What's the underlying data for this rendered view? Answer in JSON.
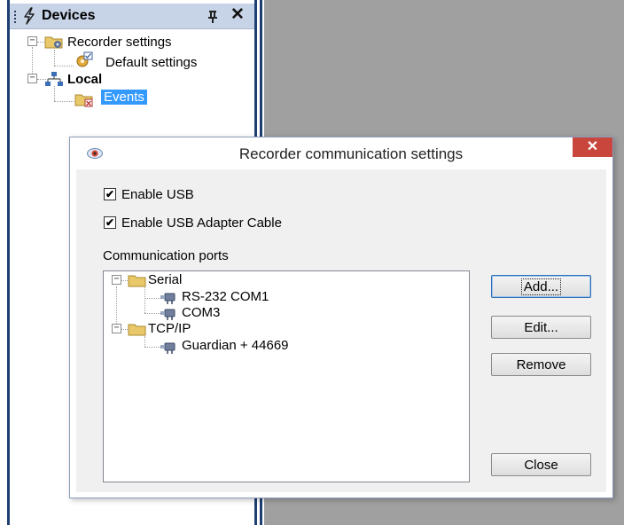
{
  "devices_pane": {
    "title": "Devices",
    "pin_glyph": "q",
    "close_glyph": "✕",
    "tree": [
      {
        "label": "Recorder settings",
        "icon": "folder-settings-icon",
        "expander": "−"
      },
      {
        "label": "Default settings",
        "icon": "gear-settings-icon"
      },
      {
        "label": "Local",
        "icon": "network-icon",
        "expander": "−"
      },
      {
        "label": "Events",
        "icon": "events-folder-icon",
        "selected": true
      }
    ]
  },
  "dialog": {
    "title": "Recorder communication settings",
    "close_glyph": "✕",
    "checkboxes": [
      {
        "label": "Enable USB",
        "checked": true,
        "mark": "✔"
      },
      {
        "label": "Enable USB Adapter Cable",
        "checked": true,
        "mark": "✔"
      }
    ],
    "ports_group_label": "Communication ports",
    "ports_tree": [
      {
        "label": "Serial",
        "icon": "folder-icon",
        "expander": "−"
      },
      {
        "label": "RS-232 COM1",
        "icon": "plug-icon"
      },
      {
        "label": "COM3",
        "icon": "plug-icon"
      },
      {
        "label": "TCP/IP",
        "icon": "folder-icon",
        "expander": "−"
      },
      {
        "label": "Guardian + 44669",
        "icon": "plug-icon"
      }
    ],
    "buttons": {
      "add": "Add...",
      "edit": "Edit...",
      "remove": "Remove",
      "close": "Close"
    }
  },
  "colors": {
    "selection": "#3399ff",
    "pane_header": "#c7d3e6",
    "workspace": "#a0a0a0",
    "close_button": "#c8463c"
  }
}
